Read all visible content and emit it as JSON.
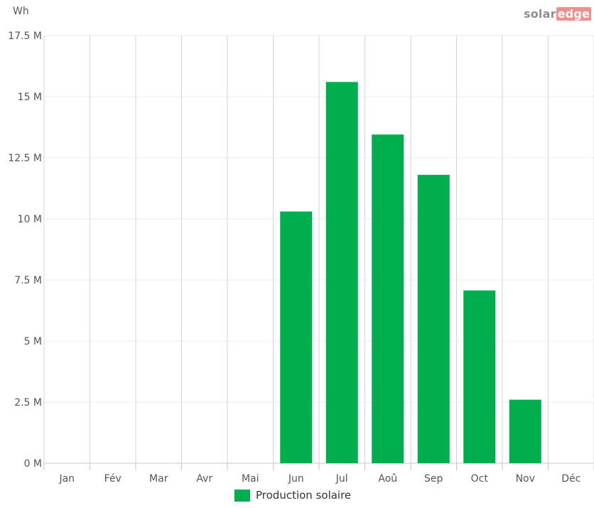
{
  "chart_data": {
    "type": "bar",
    "unit_label": "Wh",
    "categories": [
      "Jan",
      "Fév",
      "Mar",
      "Avr",
      "Mai",
      "Jun",
      "Jul",
      "Aoû",
      "Sep",
      "Oct",
      "Nov",
      "Déc"
    ],
    "series": [
      {
        "name": "Production solaire",
        "color": "#00ae4d",
        "values": [
          0,
          0,
          0,
          0,
          0,
          10.3,
          15.6,
          13.45,
          11.8,
          7.07,
          2.6,
          0
        ]
      }
    ],
    "y_ticks": [
      0,
      2.5,
      5,
      7.5,
      10,
      12.5,
      15,
      17.5
    ],
    "y_tick_labels": [
      "0 M",
      "2.5 M",
      "5 M",
      "7.5 M",
      "10 M",
      "12.5 M",
      "15 M",
      "17.5 M"
    ],
    "ylim": [
      0,
      17.5
    ],
    "grid": true,
    "legend_position": "bottom-center"
  },
  "brand": {
    "logo_part1": "solar",
    "logo_part2": "edge",
    "logo_icon": "solaredge-logo"
  }
}
